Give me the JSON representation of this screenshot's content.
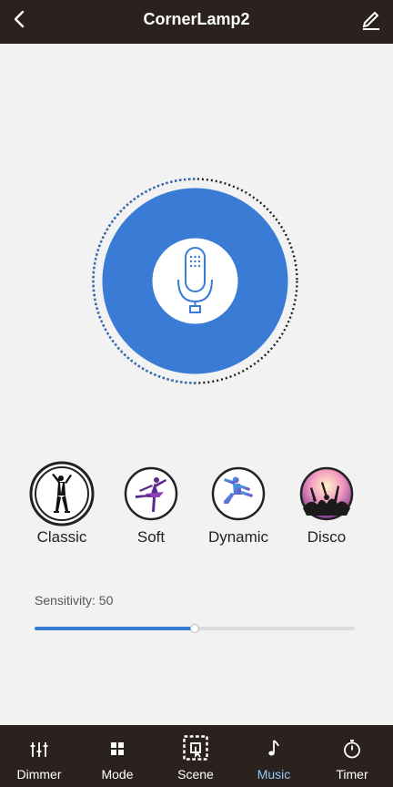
{
  "header": {
    "title": "CornerLamp2",
    "back_icon": "chevron-left-icon",
    "edit_icon": "edit-pencil-icon"
  },
  "mic": {
    "icon": "microphone-icon",
    "accent_color": "#3a7bd5"
  },
  "modes": [
    {
      "label": "Classic",
      "icon": "dancer-classic-icon",
      "selected": true
    },
    {
      "label": "Soft",
      "icon": "ballerina-icon",
      "selected": false
    },
    {
      "label": "Dynamic",
      "icon": "jumping-dancer-icon",
      "selected": false
    },
    {
      "label": "Disco",
      "icon": "disco-crowd-icon",
      "selected": false
    }
  ],
  "sensitivity": {
    "label": "Sensitivity: 50",
    "value": 50,
    "max": 100
  },
  "tabs": [
    {
      "label": "Dimmer",
      "icon": "sliders-icon",
      "active": false
    },
    {
      "label": "Mode",
      "icon": "grid-icon",
      "active": false
    },
    {
      "label": "Scene",
      "icon": "scene-select-icon",
      "active": false
    },
    {
      "label": "Music",
      "icon": "music-note-icon",
      "active": true
    },
    {
      "label": "Timer",
      "icon": "stopwatch-icon",
      "active": false
    }
  ],
  "colors": {
    "bar_background": "#2b2220",
    "page_background": "#f2f2f2",
    "active_tab": "#8fc8f4"
  }
}
